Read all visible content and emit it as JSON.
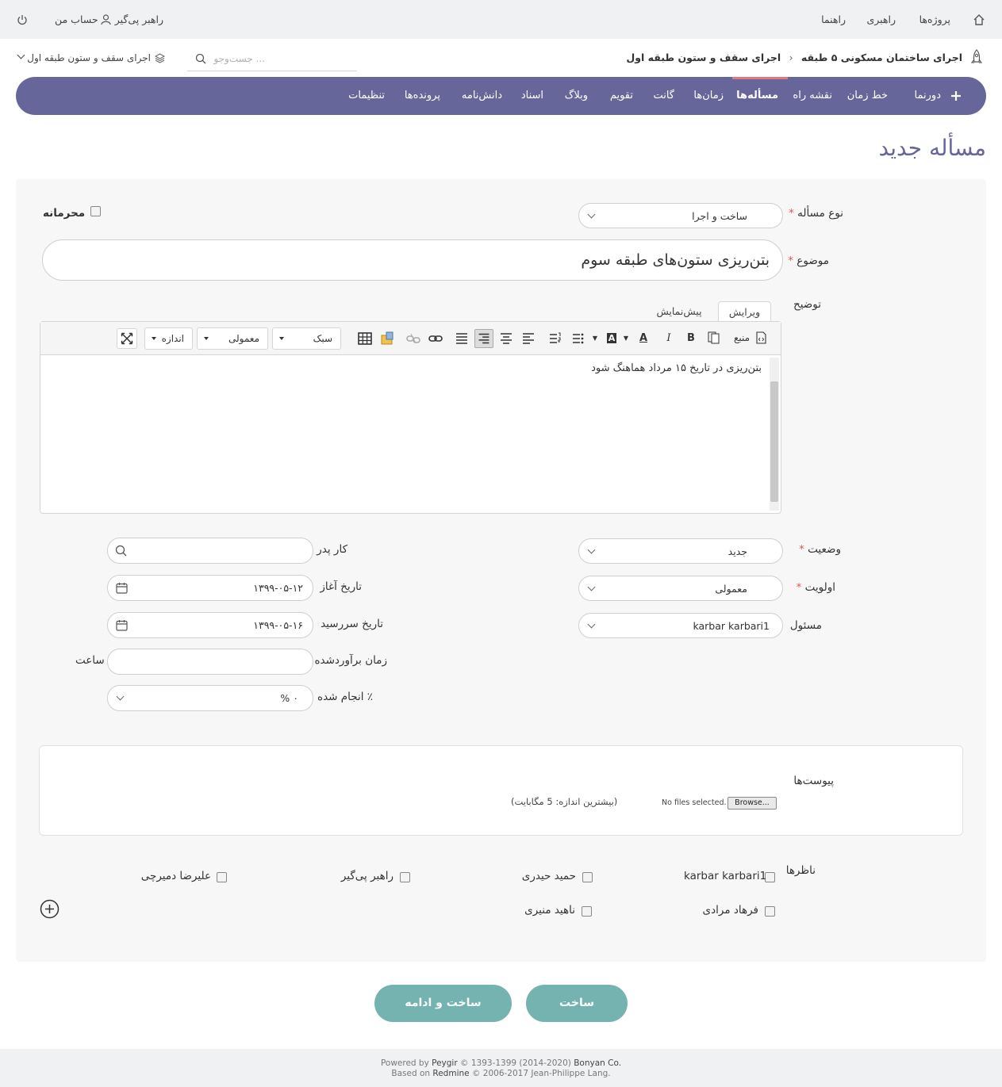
{
  "topbar": {
    "projects": "پروژه‌ها",
    "admin": "راهبری",
    "help": "راهنما",
    "my_account": "حساب من",
    "user": "راهبر پی‌گیر"
  },
  "header": {
    "breadcrumb_parent": "اجرای ساختمان مسکونی ۵ طبقه",
    "breadcrumb_current": "اجرای سقف و ستون طبقه اول",
    "search_placeholder": "... جست‌وجو",
    "project_selector": "اجرای سقف و ستون طبقه اول"
  },
  "nav": {
    "items": [
      "دورنما",
      "خط زمان",
      "نقشه راه",
      "مسأله‌ها",
      "زمان‌ها",
      "گانت",
      "تقویم",
      "وبلاگ",
      "اسناد",
      "دانش‌نامه",
      "پرونده‌ها",
      "تنظیمات"
    ],
    "active": "مسأله‌ها"
  },
  "page_title": "مسأله جدید",
  "form": {
    "tracker_label": "نوع مسأله",
    "tracker_value": "ساخت و اجرا",
    "private_label": "محرمانه",
    "subject_label": "موضوع",
    "subject_value": "بتن‌ریزی ستون‌های طبقه سوم",
    "description_label": "توضیح",
    "tab_edit": "ویرایش",
    "tab_preview": "پیش‌نمایش",
    "description_value": "بتن‌ریزی در تاریخ ۱۵ مرداد هماهنگ شود",
    "status_label": "وضعیت",
    "status_value": "جدید",
    "priority_label": "اولویت",
    "priority_value": "معمولی",
    "assignee_label": "مسئول",
    "assignee_value": "karbar karbari1",
    "parent_label": "کار پدر",
    "start_label": "تاریخ آغاز",
    "start_value": "۱۳۹۹-۰۵-۱۲",
    "due_label": "تاریخ سررسید",
    "due_value": "۱۳۹۹-۰۵-۱۶",
    "estimated_label": "زمان برآوردشده",
    "hours_unit": "ساعت",
    "done_label": "٪ انجام شده",
    "done_value": "۰ %"
  },
  "toolbar": {
    "source": "منبع",
    "style": "سبک",
    "format": "معمولی",
    "size": "اندازه"
  },
  "attachments": {
    "label": "پیوست‌ها",
    "browse": "Browse...",
    "no_files": "No files selected.",
    "max_size": "(بیشترین اندازه: 5 مگابایت)"
  },
  "watchers": {
    "label": "ناظرها",
    "users": [
      "karbar karbari1",
      "حمید حیدری",
      "راهبر پی‌گیر",
      "علیرضا دمیرچی",
      "فرهاد مرادی",
      "ناهید منیری"
    ]
  },
  "buttons": {
    "create": "ساخت",
    "create_continue": "ساخت و ادامه"
  },
  "footer": {
    "powered_prefix": "Powered by",
    "powered_name": "Peygir",
    "powered_years": "© 1393-1399 (2014-2020)",
    "powered_company": "Bonyan Co.",
    "based_prefix": "Based on",
    "based_name": "Redmine",
    "based_rest": "© 2006-2017 Jean-Philippe Lang."
  },
  "colors": {
    "nav_bg": "#67669a",
    "accent": "#e0787e",
    "button": "#75b3b0",
    "title": "#67669a"
  }
}
